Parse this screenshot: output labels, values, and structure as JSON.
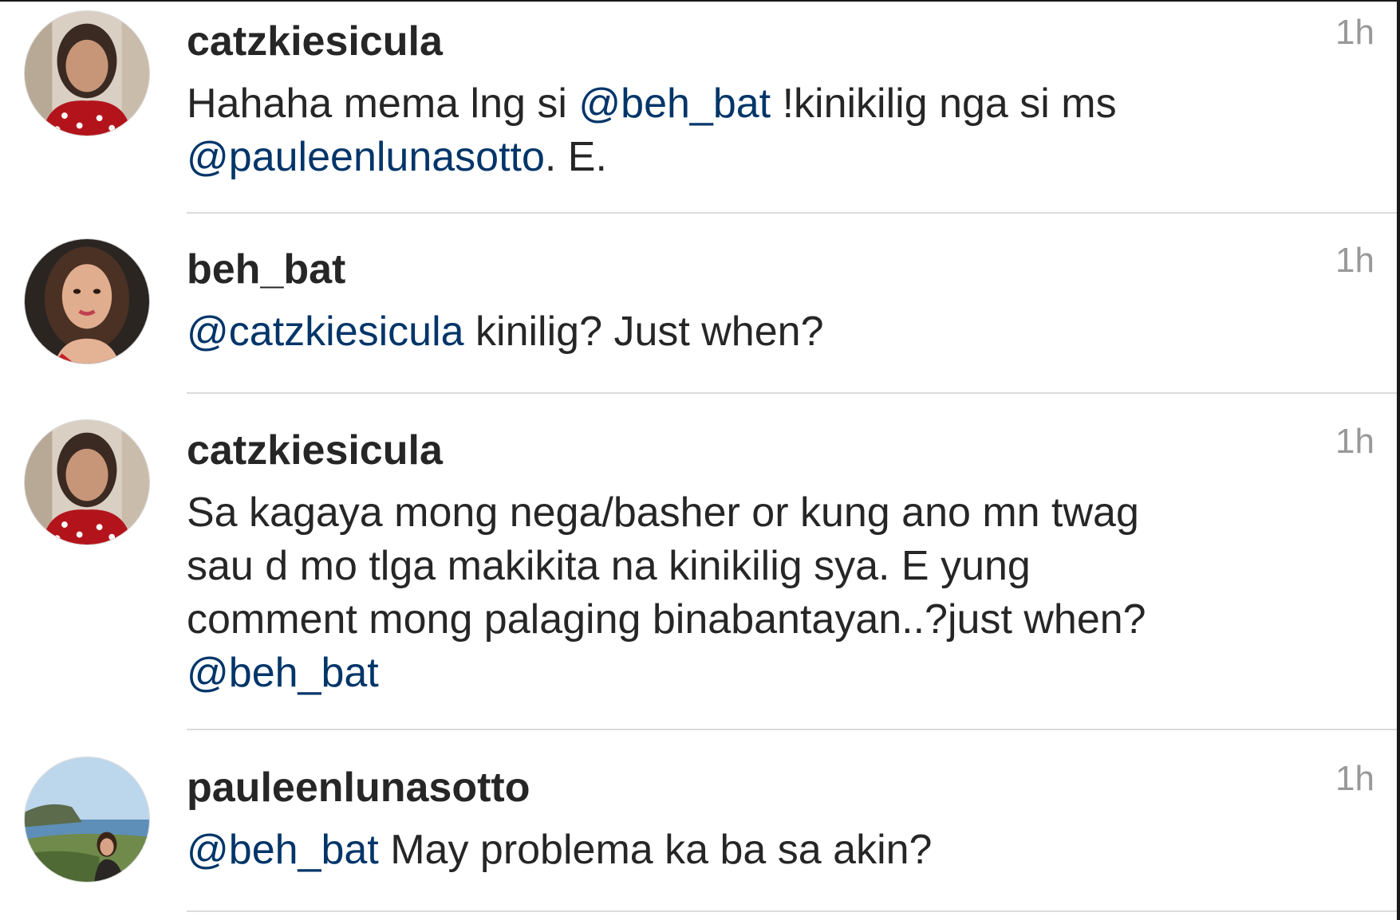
{
  "comments": [
    {
      "username": "catzkiesicula",
      "time": "1h",
      "avatar": "avatar-woman-red-polka-dot",
      "lines": [
        [
          {
            "t": "Hahaha mema lng si "
          },
          {
            "m": "@beh_bat"
          },
          {
            "t": " !kinikilig nga si ms"
          }
        ],
        [
          {
            "m": "@pauleenlunasotto"
          },
          {
            "t": ". E."
          }
        ]
      ]
    },
    {
      "username": "beh_bat",
      "time": "1h",
      "avatar": "avatar-woman-portrait",
      "lines": [
        [
          {
            "m": "@catzkiesicula"
          },
          {
            "t": " kinilig? Just when?"
          }
        ]
      ]
    },
    {
      "username": "catzkiesicula",
      "time": "1h",
      "avatar": "avatar-woman-red-polka-dot",
      "lines": [
        [
          {
            "t": "Sa kagaya mong nega/basher or kung ano mn twag"
          }
        ],
        [
          {
            "t": "sau d mo tlga makikita na kinikilig sya. E yung"
          }
        ],
        [
          {
            "t": "comment mong palaging binabantayan..?just when?"
          }
        ],
        [
          {
            "m": "@beh_bat"
          }
        ]
      ]
    },
    {
      "username": "pauleenlunasotto",
      "time": "1h",
      "avatar": "avatar-seaside-landscape",
      "lines": [
        [
          {
            "m": "@beh_bat"
          },
          {
            "t": " May problema ka ba sa akin?"
          }
        ]
      ]
    }
  ],
  "colors": {
    "mention": "#003569",
    "text": "#262626",
    "timestamp": "#999999",
    "divider": "#dbdbdb"
  }
}
